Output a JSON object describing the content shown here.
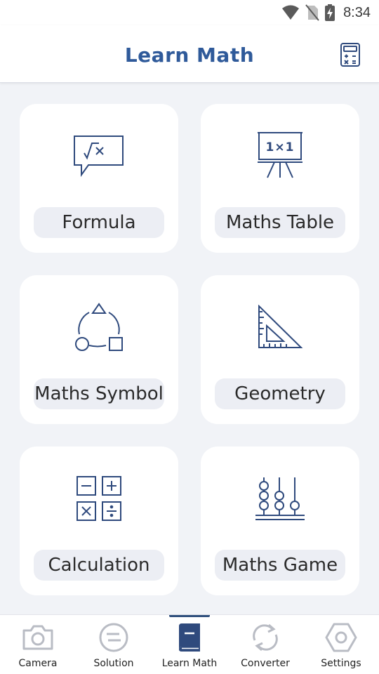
{
  "status_bar": {
    "time": "8:34"
  },
  "app_bar": {
    "title": "Learn Math",
    "action_icon": "calculator-icon"
  },
  "cards": [
    {
      "label": "Formula",
      "icon": "formula-bubble-icon"
    },
    {
      "label": "Maths Table",
      "icon": "board-easel-icon"
    },
    {
      "label": "Maths Symbol",
      "icon": "shapes-cycle-icon"
    },
    {
      "label": "Geometry",
      "icon": "set-square-icon"
    },
    {
      "label": "Calculation",
      "icon": "operators-grid-icon"
    },
    {
      "label": "Maths Game",
      "icon": "abacus-icon"
    }
  ],
  "nav": {
    "active": "Learn Math",
    "items": [
      {
        "label": "Camera",
        "icon": "camera-icon"
      },
      {
        "label": "Solution",
        "icon": "solution-icon"
      },
      {
        "label": "Learn Math",
        "icon": "book-icon"
      },
      {
        "label": "Converter",
        "icon": "converter-icon"
      },
      {
        "label": "Settings",
        "icon": "settings-icon"
      }
    ]
  },
  "colors": {
    "accent": "#2f5a9a",
    "icon_stroke": "#2f4a7d",
    "background": "#f1f3f7",
    "card": "#ffffff",
    "label_pill": "#eceef4"
  }
}
